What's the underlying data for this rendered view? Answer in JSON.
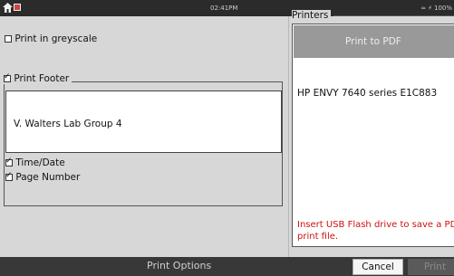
{
  "status": {
    "time": "02:41PM",
    "wifi_icon": "wifi-icon",
    "battery_icon": "battery-charging-icon",
    "battery": "100%"
  },
  "options": {
    "greyscale_label": "Print in greyscale",
    "greyscale_checked": false,
    "footer_label": "Print Footer",
    "footer_checked": true,
    "footer_text": "V. Walters Lab Group 4",
    "time_date_label": "Time/Date",
    "time_date_checked": true,
    "page_number_label": "Page Number",
    "page_number_checked": true
  },
  "printers": {
    "label": "Printers",
    "items": [
      "Print to PDF",
      "HP ENVY 7640 series E1C883"
    ],
    "selected": "Print to PDF",
    "usb_note": "Insert USB Flash drive to save a PDF print file."
  },
  "bottom": {
    "title": "Print Options",
    "cancel_label": "Cancel",
    "print_label": "Print"
  },
  "colors": {
    "warning": "#cc1111",
    "selected_row": "#999999"
  }
}
